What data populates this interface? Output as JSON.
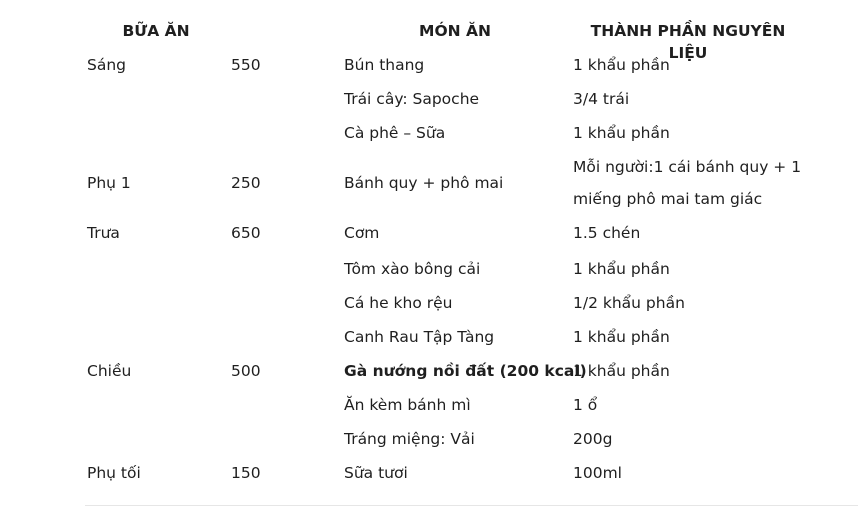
{
  "headers": {
    "meal": "BỮA ĂN",
    "dish": "MÓN ĂN",
    "ingredients": "THÀNH PHẦN NGUYÊN LIỆU"
  },
  "rows": [
    {
      "meal": "Sáng",
      "kcal": "550",
      "dish": "Bún thang",
      "ingredients": "1 khẩu phần"
    },
    {
      "meal": "",
      "kcal": "",
      "dish": "Trái cây: Sapoche",
      "ingredients": "3/4 trái"
    },
    {
      "meal": "",
      "kcal": "",
      "dish": "Cà phê – Sữa",
      "ingredients": "1 khẩu phần"
    },
    {
      "meal": "Phụ 1",
      "kcal": "250",
      "dish": "Bánh quy + phô mai",
      "ingredients": "Mỗi người:1 cái bánh quy + 1 miếng phô mai tam giác"
    },
    {
      "meal": "Trưa",
      "kcal": "650",
      "dish": "Cơm",
      "ingredients": "1.5 chén"
    },
    {
      "meal": "",
      "kcal": "",
      "dish": "Tôm xào bông cải",
      "ingredients": "1 khẩu phần"
    },
    {
      "meal": "",
      "kcal": "",
      "dish": "Cá he kho rệu",
      "ingredients": "1/2 khẩu phần"
    },
    {
      "meal": "",
      "kcal": "",
      "dish": "Canh Rau Tập Tàng",
      "ingredients": "1 khẩu phần"
    },
    {
      "meal": "Chiều",
      "kcal": "500",
      "dish": "Gà nướng nồi đất (200 kcal)",
      "ingredients": "1 khẩu phần"
    },
    {
      "meal": "",
      "kcal": "",
      "dish": "Ăn kèm bánh mì",
      "ingredients": "1 ổ"
    },
    {
      "meal": "",
      "kcal": "",
      "dish": "Tráng miệng: Vải",
      "ingredients": "200g"
    },
    {
      "meal": "Phụ tối",
      "kcal": "150",
      "dish": "Sữa tươi",
      "ingredients": "100ml"
    }
  ]
}
